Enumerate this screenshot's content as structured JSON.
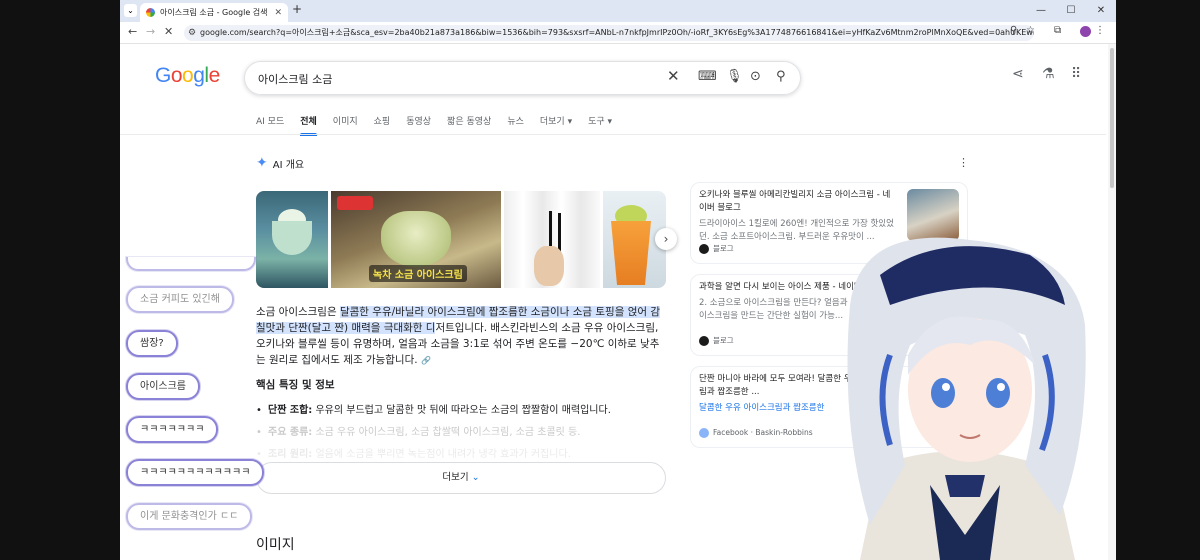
{
  "browser": {
    "tab_title": "아이스크림 소금 - Google 검색",
    "new_tab": "+",
    "url": "google.com/search?q=아이스크림+소금&sca_esv=2ba40b21a873a186&biw=1536&bih=793&sxsrf=ANbL-n7nkfpJmrIPz0Oh/-ioRf_3KY6sEg%3A1774876616841&ei=yHfKaZv6Mtnm2roPlMnXoQE&ved=0ahUKEwib_pDS2seTAxVZs1YBHZTkNRQQ..."
  },
  "google": {
    "logo": [
      "G",
      "o",
      "o",
      "g",
      "l",
      "e"
    ],
    "query": "아이스크림 소금",
    "tabs": [
      {
        "label": "AI 모드"
      },
      {
        "label": "전체"
      },
      {
        "label": "이미지"
      },
      {
        "label": "쇼핑"
      },
      {
        "label": "동영상"
      },
      {
        "label": "짧은 동영상"
      },
      {
        "label": "뉴스"
      },
      {
        "label": "더보기 ▾"
      },
      {
        "label": "도구 ▾"
      }
    ],
    "active_tab": "전체"
  },
  "ai_overview": {
    "title": "AI 개요",
    "image_caption": "녹차 소금 아이스크림",
    "summary_pre": "소금 아이스크림은 ",
    "summary_hl": "달콤한 우유/바닐라 아이스크림에 짭조름한 소금이나 소금 토핑을 얹어 감칠맛과 단짠(달고 짠) 매력을 극대화한 디",
    "summary_post": "저트입니다. 배스킨라빈스의 소금 우유 아이스크림, 오키나와 블루씰 등이 유명하며, 얼음과 소금을 3:1로 섞어 주변 온도를 −20℃ 이하로 낮추는 원리로 집에서도 제조 가능합니다.",
    "key_heading": "핵심 특징 및 정보",
    "bullets": [
      {
        "bold": "단짠 조합:",
        "text": " 우유의 부드럽고 달콤한 맛 뒤에 따라오는 소금의 짭짤함이 매력입니다."
      },
      {
        "bold": "주요 종류:",
        "text": " 소금 우유 아이스크림, 소금 찹쌀떡 아이스크림, 소금 초콜릿 등."
      },
      {
        "bold": "조리 원리:",
        "text": " 얼음에 소금을 뿌리면 녹는점이 내려가 냉각 효과가 커집니다."
      }
    ],
    "more_label": "더보기"
  },
  "sources": [
    {
      "title": "오키나와 블루씰 아메리칸빌리지 소금 아이스크림 - 네이버 블로그",
      "snippet": "드라이아이스 1킬로에 260엔! 개인적으로 가장 핫있었던. 소금 소프트아이스크림. 부드러운 우유맛이 ...",
      "source": "블로그"
    },
    {
      "title": "과학을 알면 다시 보이는 아이스 제품 - 네이버 블로그",
      "snippet": "2. 소금으로 아이스크림을 만든다? 얼음과 소금으로 아이스크림을 만드는 간단한 실험이 가능...",
      "source": "블로그"
    },
    {
      "title": "단짠 마니아 바라에 모두 모여라! 달콤한 우유 아이스크림과 짭조름한 ...",
      "snippet": "달콤한 우유 아이스크림과 짭조름한",
      "source": "Facebook · Baskin-Robbins"
    }
  ],
  "images_heading": "이미지",
  "chat": [
    {
      "text": "소금 커피도 있긴해"
    },
    {
      "text": "쌈장?"
    },
    {
      "text": "아이스크름"
    },
    {
      "text": "ㅋㅋㅋㅋㅋㅋㅋ"
    },
    {
      "text": "ㅋㅋㅋㅋㅋㅋㅋㅋㅋㅋㅋㅋ"
    },
    {
      "text": "이게 문화충격인가 ㄷㄷ"
    }
  ]
}
